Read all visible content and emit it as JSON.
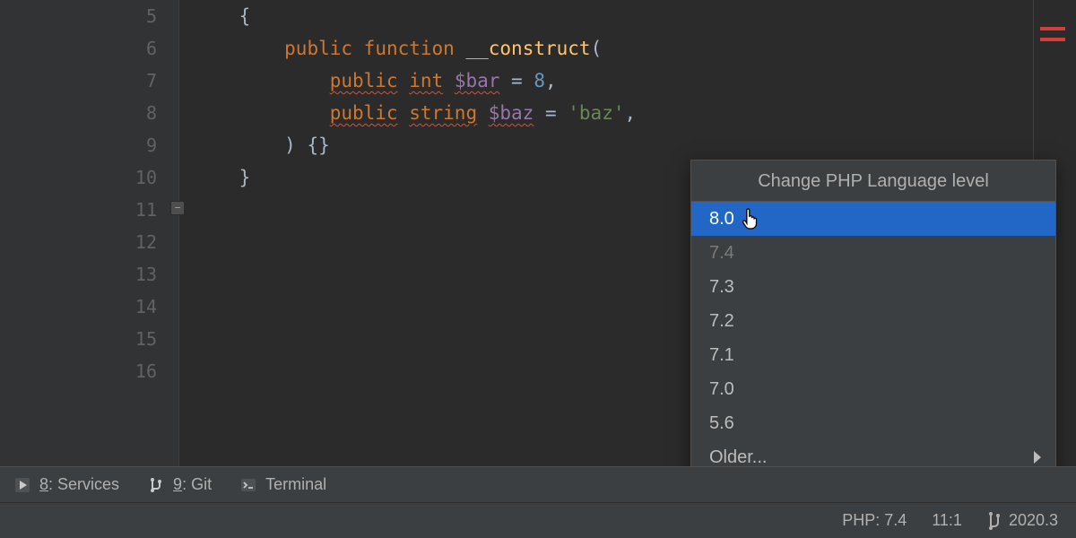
{
  "gutter": {
    "lines": [
      "5",
      "6",
      "7",
      "8",
      "9",
      "10",
      "11",
      "12",
      "13",
      "14",
      "15",
      "16"
    ]
  },
  "code": {
    "row0": {
      "brace_open": "{"
    },
    "row1": {
      "kw1": "public",
      "kw2": "function",
      "fn": "__construct",
      "lp": "("
    },
    "row2": {
      "kw": "public",
      "type": "int",
      "var": "$bar",
      "eq": " = ",
      "val": "8",
      "tail": ","
    },
    "row3": {
      "kw": "public",
      "type": "string",
      "var": "$baz",
      "eq": " = ",
      "val": "'baz'",
      "tail": ","
    },
    "row4": {
      "rp": ") {}"
    },
    "row5": {
      "brace_close": "}"
    }
  },
  "popup": {
    "title": "Change PHP Language level",
    "items": [
      {
        "label": "8.0",
        "state": "selected"
      },
      {
        "label": "7.4",
        "state": "disabled"
      },
      {
        "label": "7.3",
        "state": "normal"
      },
      {
        "label": "7.2",
        "state": "normal"
      },
      {
        "label": "7.1",
        "state": "normal"
      },
      {
        "label": "7.0",
        "state": "normal"
      },
      {
        "label": "5.6",
        "state": "normal"
      },
      {
        "label": "Older...",
        "state": "submenu"
      }
    ]
  },
  "toolwindows": {
    "services": {
      "key": "8",
      "label": ": Services"
    },
    "git": {
      "key": "9",
      "label": ": Git"
    },
    "terminal": {
      "label": "Terminal"
    }
  },
  "status": {
    "php": "PHP: 7.4",
    "pos": "11:1",
    "branch": "2020.3"
  }
}
